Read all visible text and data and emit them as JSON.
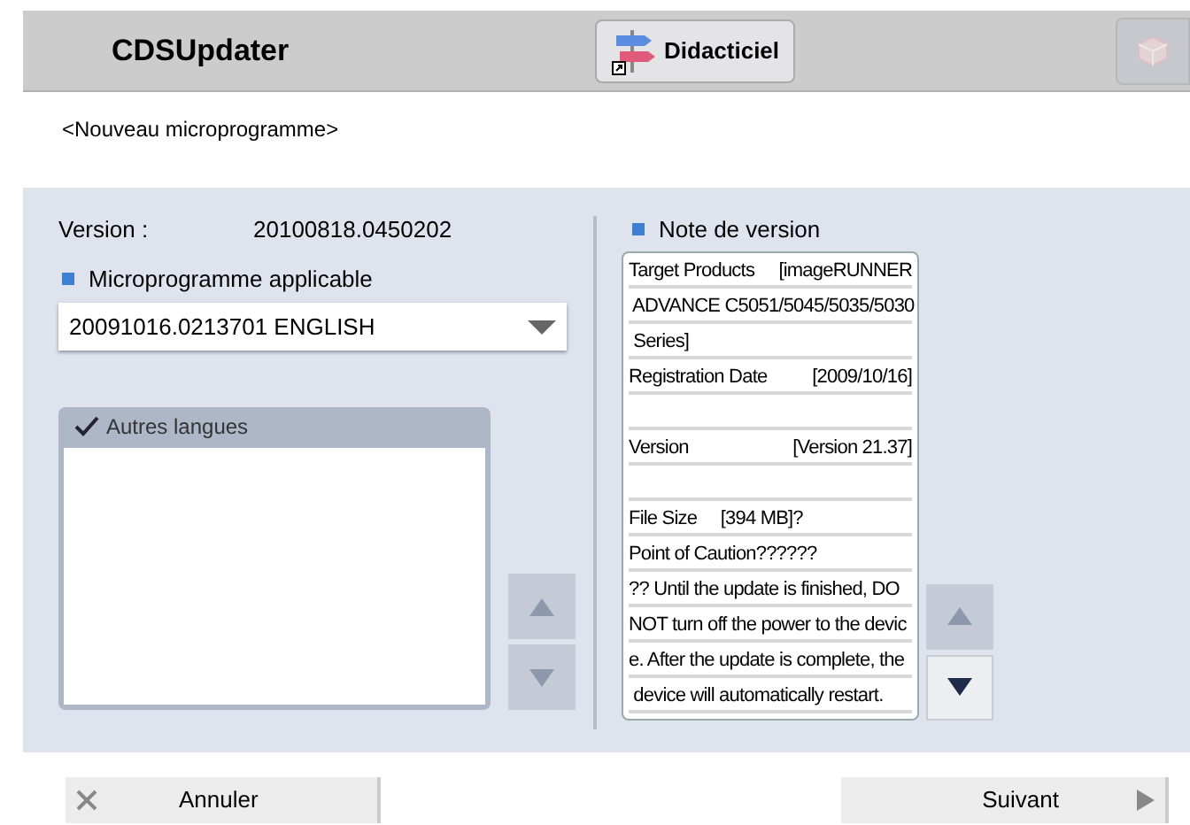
{
  "header": {
    "title": "CDSUpdater",
    "tutorial_button": "Didacticiel",
    "side_button": {
      "disabled": true
    }
  },
  "subtitle": "<Nouveau microprogramme>",
  "left": {
    "version_label": "Version :",
    "version_value": "20100818.0450202",
    "firmware_label": "Microprogramme applicable",
    "firmware_value": "20091016.0213701 ENGLISH",
    "other_languages": {
      "label": "Autres langues",
      "checked": true
    },
    "scroll_buttons": [
      {
        "kind": "up",
        "disabled": true
      },
      {
        "kind": "down",
        "disabled": true
      }
    ]
  },
  "right": {
    "label": "Note de version",
    "lines": [
      {
        "kind": "pair",
        "label": "Target Products",
        "value": "[imageRUNNER"
      },
      {
        "kind": "text",
        "text": " ADVANCE C5051/5045/5035/5030"
      },
      {
        "kind": "text",
        "text": " Series]"
      },
      {
        "kind": "pair",
        "label": "Registration Date",
        "value": "[2009/10/16]"
      },
      {
        "kind": "blank"
      },
      {
        "kind": "pair",
        "label": "Version",
        "value": "[Version 21.37]"
      },
      {
        "kind": "blank"
      },
      {
        "kind": "text",
        "text": "File Size     [394 MB]?"
      },
      {
        "kind": "text",
        "text": "Point of Caution??????"
      },
      {
        "kind": "text",
        "text": "?? Until the update is finished, DO"
      },
      {
        "kind": "text",
        "text": "NOT turn off the power to the devic"
      },
      {
        "kind": "text",
        "text": "e. After the update is complete, the"
      },
      {
        "kind": "text",
        "text": " device will automatically restart."
      }
    ],
    "scroll_buttons": [
      {
        "kind": "up",
        "disabled": true
      },
      {
        "kind": "down",
        "disabled": false
      }
    ]
  },
  "footer": {
    "cancel": "Annuler",
    "next": "Suivant"
  }
}
